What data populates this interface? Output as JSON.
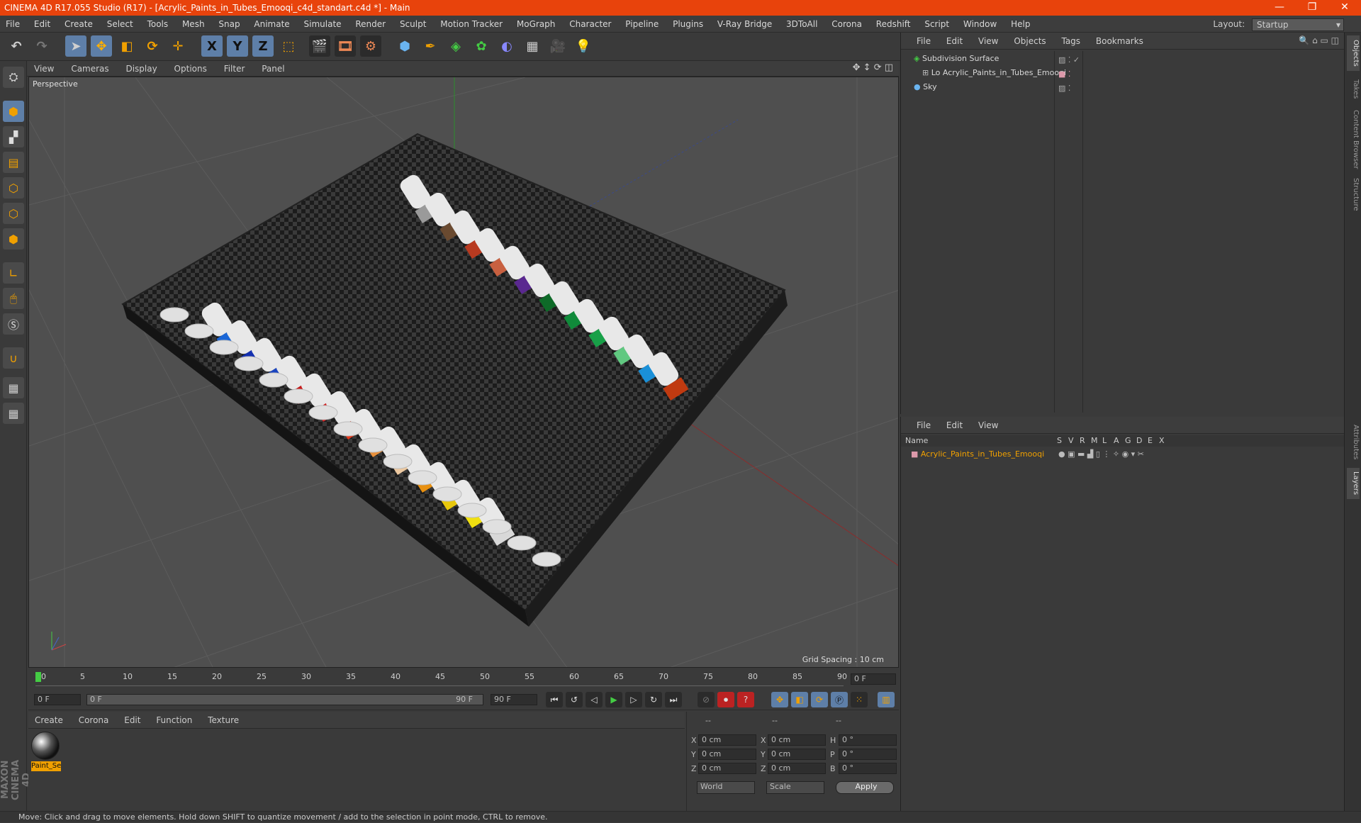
{
  "window": {
    "title": "CINEMA 4D R17.055 Studio (R17) - [Acrylic_Paints_in_Tubes_Emooqi_c4d_standart.c4d *] - Main",
    "minimize": "—",
    "restore": "❐",
    "close": "✕"
  },
  "menu": [
    "File",
    "Edit",
    "Create",
    "Select",
    "Tools",
    "Mesh",
    "Snap",
    "Animate",
    "Simulate",
    "Render",
    "Sculpt",
    "Motion Tracker",
    "MoGraph",
    "Character",
    "Pipeline",
    "Plugins",
    "V-Ray Bridge",
    "3DToAll",
    "Corona",
    "Redshift",
    "Script",
    "Window",
    "Help"
  ],
  "layout": {
    "label": "Layout:",
    "value": "Startup"
  },
  "toolbar": {
    "x_label": "X",
    "y_label": "Y",
    "z_label": "Z"
  },
  "viewport": {
    "menu": [
      "View",
      "Cameras",
      "Display",
      "Options",
      "Filter",
      "Panel"
    ],
    "label": "Perspective",
    "grid_spacing": "Grid Spacing : 10 cm"
  },
  "timeline": {
    "ticks": [
      "0",
      "5",
      "10",
      "15",
      "20",
      "25",
      "30",
      "35",
      "40",
      "45",
      "50",
      "55",
      "60",
      "65",
      "70",
      "75",
      "80",
      "85",
      "90"
    ],
    "current_frame": "0 F",
    "start_field": "0 F",
    "range_start": "0 F",
    "range_end": "90 F",
    "end_field": "90 F"
  },
  "material_panel": {
    "menu": [
      "Create",
      "Corona",
      "Edit",
      "Function",
      "Texture"
    ],
    "material_name": "Paint_Se"
  },
  "coords": {
    "header": [
      "--",
      "--",
      "--"
    ],
    "rows": [
      {
        "a": "X",
        "v1": "0 cm",
        "b": "X",
        "v2": "0 cm",
        "c": "H",
        "v3": "0 °"
      },
      {
        "a": "Y",
        "v1": "0 cm",
        "b": "Y",
        "v2": "0 cm",
        "c": "P",
        "v3": "0 °"
      },
      {
        "a": "Z",
        "v1": "0 cm",
        "b": "Z",
        "v2": "0 cm",
        "c": "B",
        "v3": "0 °"
      }
    ],
    "space": "World",
    "mode": "Scale",
    "apply": "Apply"
  },
  "status": "Move: Click and drag to move elements. Hold down SHIFT to quantize movement / add to the selection in point mode, CTRL to remove.",
  "object_manager": {
    "menu": [
      "File",
      "Edit",
      "View",
      "Objects",
      "Tags",
      "Bookmarks"
    ],
    "objects": [
      {
        "name": "Subdivision Surface"
      },
      {
        "name": "Acrylic_Paints_in_Tubes_Emooqi"
      },
      {
        "name": "Sky"
      }
    ]
  },
  "layer_manager": {
    "menu": [
      "File",
      "Edit",
      "View"
    ],
    "columns": [
      "Name",
      "S",
      "V",
      "R",
      "M",
      "L",
      "A",
      "G",
      "D",
      "E",
      "X"
    ],
    "layers": [
      {
        "name": "Acrylic_Paints_in_Tubes_Emooqi"
      }
    ]
  },
  "right_tabs": [
    "Objects",
    "Takes",
    "Content Browser",
    "Structure",
    "Attributes",
    "Layers"
  ],
  "brand": "MAXON CINEMA 4D"
}
